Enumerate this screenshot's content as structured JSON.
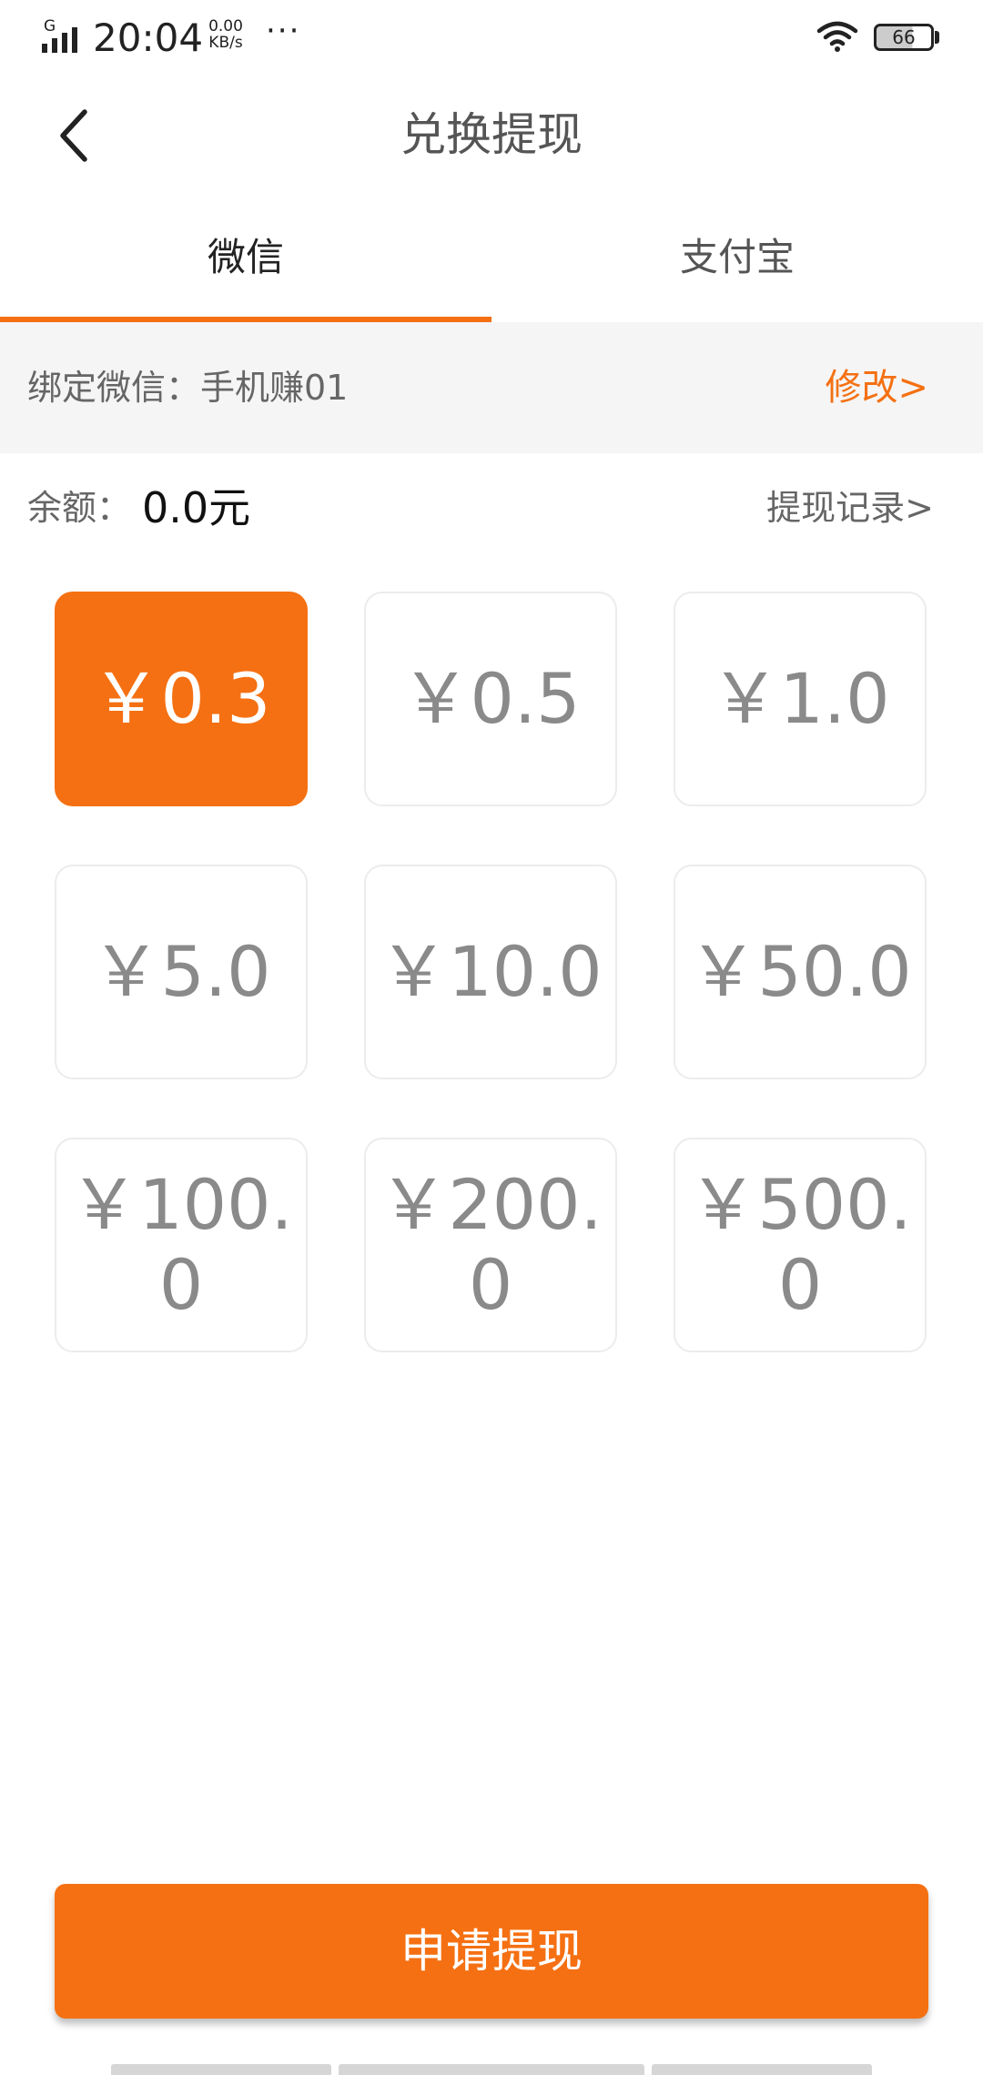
{
  "status_bar": {
    "network_type": "G",
    "time": "20:04",
    "speed_value": "0.00",
    "speed_unit": "KB/s",
    "more": "···",
    "battery_level": "66"
  },
  "nav": {
    "back_icon": "chevron-left-icon",
    "title": "兑换提现"
  },
  "tabs": [
    {
      "label": "微信",
      "active": true
    },
    {
      "label": "支付宝",
      "active": false
    }
  ],
  "binding": {
    "label": "绑定微信：手机赚01",
    "modify_label": "修改>"
  },
  "balance": {
    "label": "余额：",
    "value": "0.0元",
    "records_label": "提现记录>"
  },
  "amounts": [
    {
      "label": "￥0.3",
      "selected": true
    },
    {
      "label": "￥0.5",
      "selected": false
    },
    {
      "label": "￥1.0",
      "selected": false
    },
    {
      "label": "￥5.0",
      "selected": false
    },
    {
      "label": "￥10.0",
      "selected": false
    },
    {
      "label": "￥50.0",
      "selected": false
    },
    {
      "label": "￥100.0",
      "selected": false
    },
    {
      "label": "￥200.0",
      "selected": false
    },
    {
      "label": "￥500.0",
      "selected": false
    }
  ],
  "submit_label": "申请提现",
  "colors": {
    "accent": "#f57012",
    "card_text": "#8a8a8a",
    "bind_bg": "#f5f5f5"
  }
}
